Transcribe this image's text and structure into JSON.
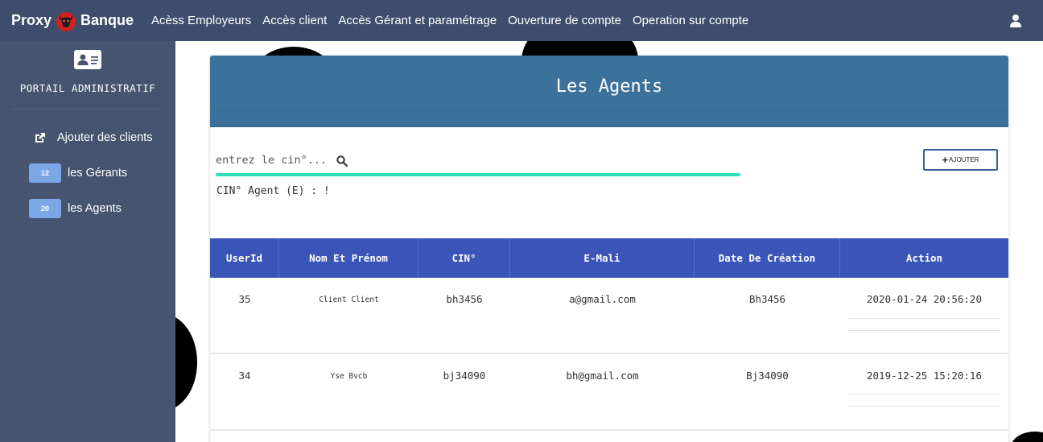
{
  "brand": {
    "left": "Proxy",
    "right": "Banque"
  },
  "nav": {
    "items": [
      "Acèss Employeurs",
      "Accès client",
      "Accès Gérant et paramétrage",
      "Ouverture de compte",
      "Operation sur compte"
    ]
  },
  "sidebar": {
    "title": "PORTAIL ADMINISTRATIF",
    "add_clients": "Ajouter des clients",
    "items": [
      {
        "badge": "12",
        "label": "les Gérants"
      },
      {
        "badge": "20",
        "label": "les Agents"
      }
    ]
  },
  "card": {
    "title": "Les Agents",
    "search_placeholder": "entrez le cin°....",
    "cin_label": "CIN° Agent (E) : !",
    "add_button": "AJOUTER"
  },
  "table": {
    "headers": [
      "UserId",
      "Nom Et Prénom",
      "CIN°",
      "E-Mali",
      "Date De Création",
      "Action"
    ],
    "rows": [
      [
        "35",
        "Client Client",
        "bh3456",
        "a@gmail.com",
        "Bh3456",
        "2020-01-24 20:56:20"
      ],
      [
        "34",
        "Yse Bvcb",
        "bj34090",
        "bh@gmail.com",
        "Bj34090",
        "2019-12-25 15:20:16"
      ]
    ]
  },
  "colors": {
    "navbar": "#3d4d6b",
    "sidebar": "#46546f",
    "card_header": "#3c719a",
    "table_header": "#3a54b8",
    "search_underline": "#2ee0b6",
    "badge": "#7aa7e6"
  },
  "icons": [
    "devil-logo-icon",
    "user-icon",
    "id-card-icon",
    "external-link-icon",
    "search-icon"
  ]
}
